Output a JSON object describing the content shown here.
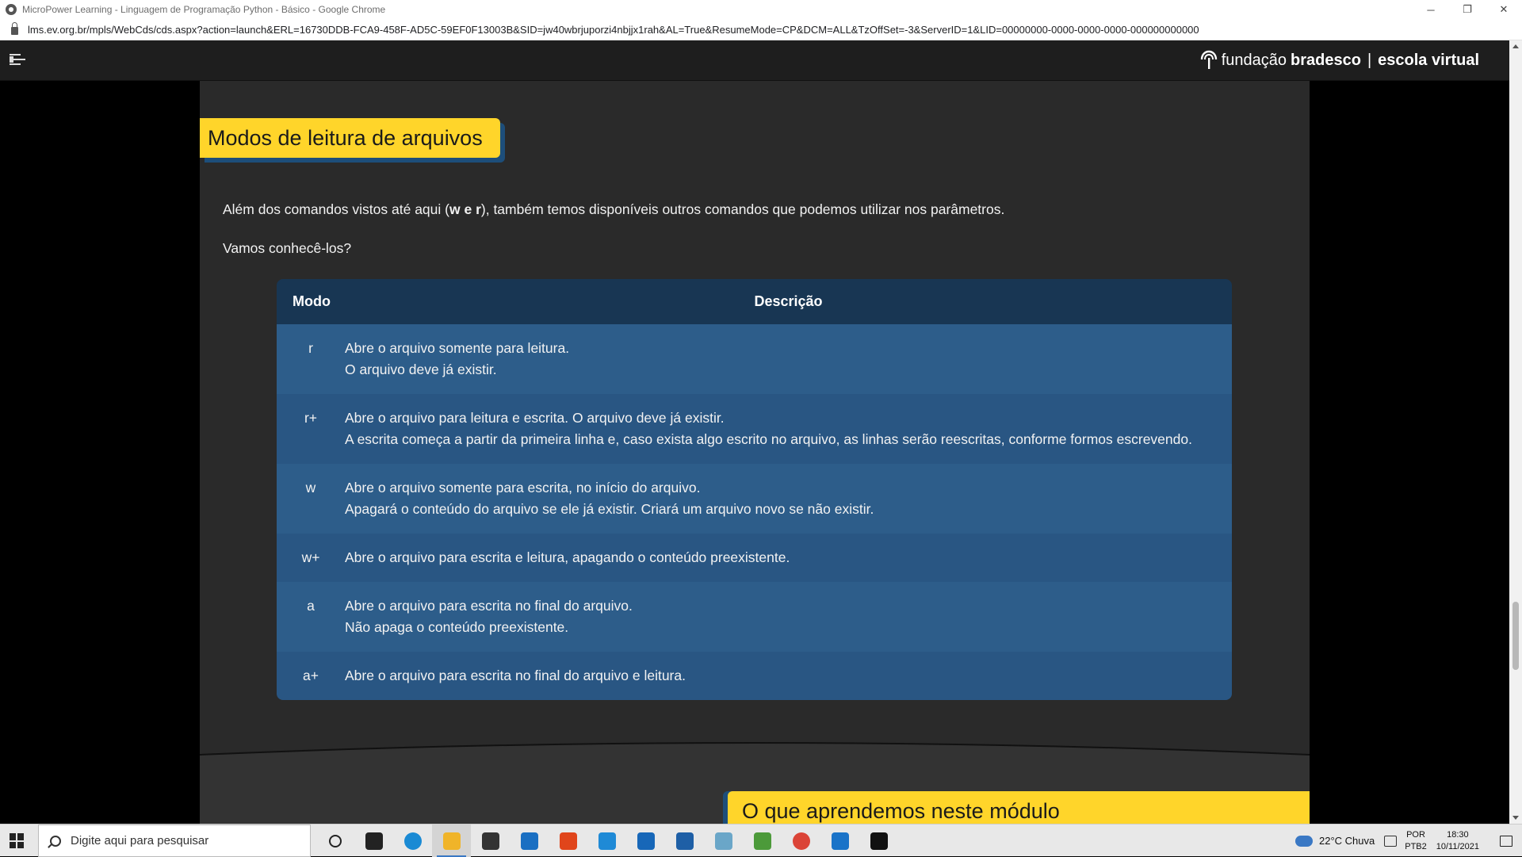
{
  "window": {
    "title": "MicroPower Learning - Linguagem de Programação Python - Básico - Google Chrome",
    "url": "lms.ev.org.br/mpls/WebCds/cds.aspx?action=launch&ERL=16730DDB-FCA9-458F-AD5C-59EF0F13003B&SID=jw40wbrjuporzi4nbjjx1rah&AL=True&ResumeMode=CP&DCM=ALL&TzOffSet=-3&ServerID=1&LID=00000000-0000-0000-0000-000000000000",
    "controls": {
      "minimize": "─",
      "restore": "❐",
      "close": "✕"
    }
  },
  "header": {
    "brand_part1": "fundação",
    "brand_part2": "bradesco",
    "brand_sep": "|",
    "brand_part3": "escola virtual"
  },
  "lesson": {
    "section_title": "Modos de leitura de arquivos",
    "intro_before": "Além dos comandos vistos até aqui (",
    "intro_w": "w",
    "intro_mid": " e ",
    "intro_r": "r",
    "intro_after": "), também temos disponíveis outros comandos que podemos utilizar nos parâmetros.",
    "question": "Vamos conhecê-los?",
    "table": {
      "headers": {
        "mode": "Modo",
        "description": "Descrição"
      },
      "rows": [
        {
          "mode": "r",
          "line1": "Abre o arquivo somente para leitura.",
          "line2": "O arquivo deve já existir."
        },
        {
          "mode": "r+",
          "line1": "Abre o arquivo para leitura e escrita. O arquivo deve já existir.",
          "line2": "A escrita começa a partir da primeira linha e, caso exista algo escrito no arquivo, as linhas serão reescritas, conforme formos escrevendo."
        },
        {
          "mode": "w",
          "line1": "Abre o arquivo somente para escrita, no início do arquivo.",
          "line2": "Apagará o conteúdo do arquivo se ele já existir. Criará um arquivo novo se não existir."
        },
        {
          "mode": "w+",
          "line1": "Abre o arquivo para escrita e leitura, apagando o conteúdo preexistente.",
          "line2": ""
        },
        {
          "mode": "a",
          "line1": "Abre o arquivo para escrita no final do arquivo.",
          "line2": "Não apaga o conteúdo preexistente."
        },
        {
          "mode": "a+",
          "line1": "Abre o arquivo para escrita no final do arquivo e leitura.",
          "line2": ""
        }
      ]
    },
    "next_section_title": "O que aprendemos neste módulo"
  },
  "taskbar": {
    "search_placeholder": "Digite aqui para pesquisar",
    "weather": "22°C  Chuva",
    "lang_top": "POR",
    "lang_bottom": "PTB2",
    "time": "18:30",
    "date": "10/11/2021",
    "icons": [
      {
        "name": "cortana-icon",
        "color": "#222222"
      },
      {
        "name": "task-view-icon",
        "color": "#222222"
      },
      {
        "name": "edge-icon",
        "color": "#1a8ad4"
      },
      {
        "name": "file-explorer-icon",
        "color": "#f0b429"
      },
      {
        "name": "store-icon",
        "color": "#333333"
      },
      {
        "name": "mail-icon",
        "color": "#1a6fc2"
      },
      {
        "name": "office-icon",
        "color": "#e0451b"
      },
      {
        "name": "vscode-icon",
        "color": "#1f8ad6"
      },
      {
        "name": "app-window-icon",
        "color": "#1767b8"
      },
      {
        "name": "app-round-icon",
        "color": "#1e5fa6"
      },
      {
        "name": "notepad-icon",
        "color": "#6aa6c8"
      },
      {
        "name": "sketch-icon",
        "color": "#4c9a3a"
      },
      {
        "name": "chrome-icon",
        "color": "#db4437"
      },
      {
        "name": "photos-icon",
        "color": "#1a73c8"
      },
      {
        "name": "pycharm-icon",
        "color": "#111111"
      }
    ]
  }
}
